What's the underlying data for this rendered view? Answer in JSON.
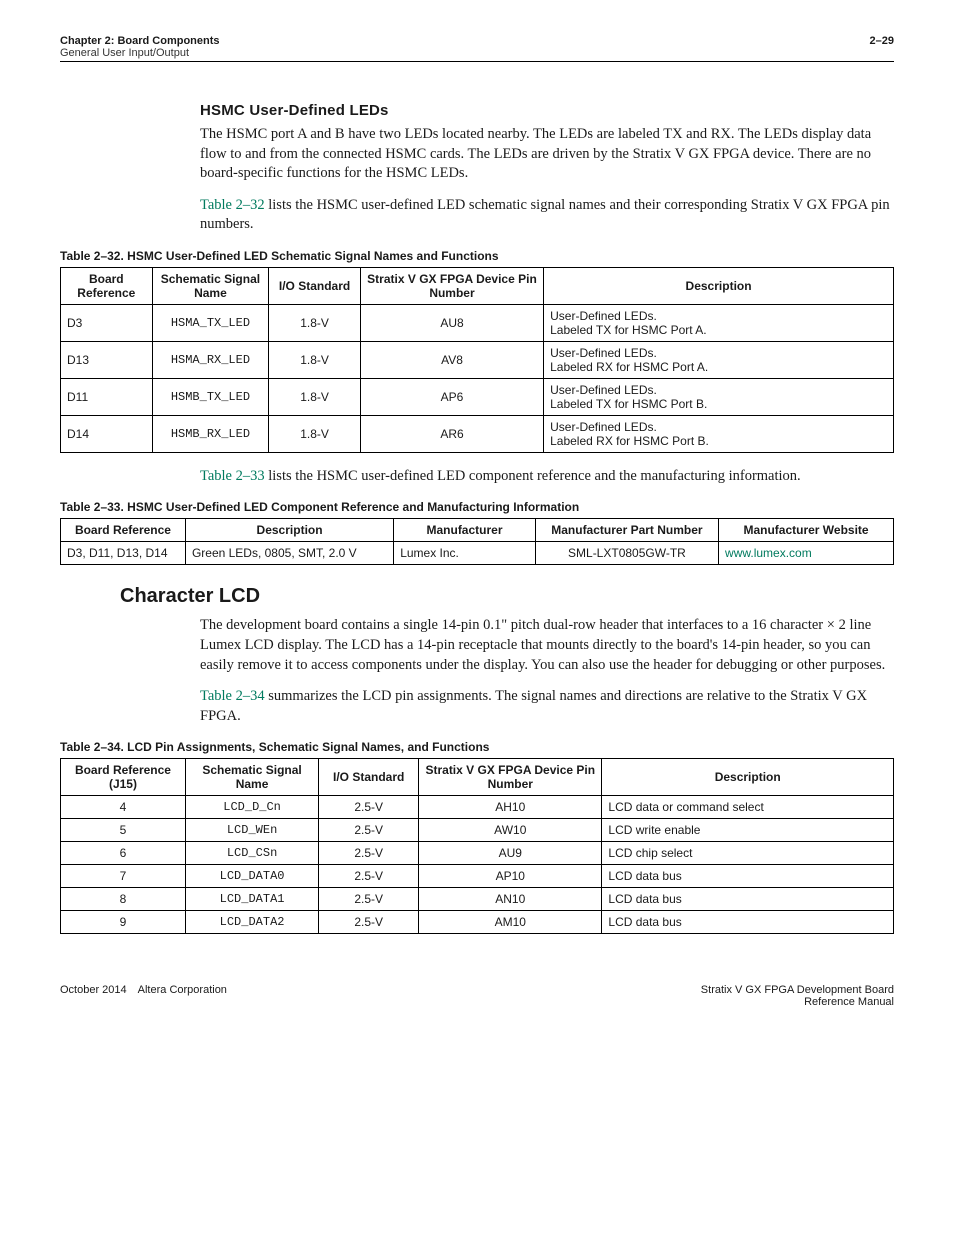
{
  "header": {
    "chapter": "Chapter 2: Board Components",
    "section": "General User Input/Output",
    "page": "2–29"
  },
  "s1": {
    "title": "HSMC User-Defined LEDs",
    "p1": "The HSMC port A and B have two LEDs located nearby. The LEDs are labeled TX and RX. The LEDs display data flow to and from the connected HSMC cards. The LEDs are driven by the Stratix V GX FPGA device. There are no board-specific functions for the HSMC LEDs.",
    "p2a": "Table 2–32",
    "p2b": " lists the HSMC user-defined LED schematic signal names and their corresponding Stratix V GX FPGA pin numbers."
  },
  "t32": {
    "caption": "Table 2–32. HSMC User-Defined LED Schematic Signal Names and Functions",
    "h": [
      "Board Reference",
      "Schematic Signal Name",
      "I/O Standard",
      "Stratix V GX FPGA Device Pin Number",
      "Description"
    ],
    "rows": [
      [
        "D3",
        "HSMA_TX_LED",
        "1.8-V",
        "AU8",
        "User-Defined LEDs.\nLabeled TX for HSMC Port A."
      ],
      [
        "D13",
        "HSMA_RX_LED",
        "1.8-V",
        "AV8",
        "User-Defined LEDs.\nLabeled RX for HSMC Port A."
      ],
      [
        "D11",
        "HSMB_TX_LED",
        "1.8-V",
        "AP6",
        "User-Defined LEDs.\nLabeled TX for HSMC Port B."
      ],
      [
        "D14",
        "HSMB_RX_LED",
        "1.8-V",
        "AR6",
        "User-Defined LEDs.\nLabeled RX for HSMC Port B."
      ]
    ]
  },
  "s2": {
    "p1a": "Table 2–33",
    "p1b": " lists the HSMC user-defined LED component reference and the manufacturing information."
  },
  "t33": {
    "caption": "Table 2–33. HSMC User-Defined LED Component Reference and Manufacturing Information",
    "h": [
      "Board Reference",
      "Description",
      "Manufacturer",
      "Manufacturer Part Number",
      "Manufacturer Website"
    ],
    "rows": [
      [
        "D3, D11, D13, D14",
        "Green LEDs, 0805, SMT, 2.0 V",
        "Lumex Inc.",
        "SML-LXT0805GW-TR",
        "www.lumex.com"
      ]
    ]
  },
  "s3": {
    "title": "Character LCD",
    "p1": "The development board contains a single 14-pin 0.1\" pitch dual-row header that interfaces to a 16 character × 2 line Lumex LCD display. The LCD has a 14-pin receptacle that mounts directly to the board's 14-pin header, so you can easily remove it to access components under the display. You can also use the header for debugging or other purposes.",
    "p2a": "Table 2–34",
    "p2b": " summarizes the LCD pin assignments. The signal names and directions are relative to the Stratix V GX FPGA."
  },
  "t34": {
    "caption": "Table 2–34. LCD Pin Assignments, Schematic Signal Names, and Functions",
    "h": [
      "Board Reference (J15)",
      "Schematic Signal Name",
      "I/O Standard",
      "Stratix V GX FPGA Device Pin Number",
      "Description"
    ],
    "rows": [
      [
        "4",
        "LCD_D_Cn",
        "2.5-V",
        "AH10",
        "LCD data or command select"
      ],
      [
        "5",
        "LCD_WEn",
        "2.5-V",
        "AW10",
        "LCD write enable"
      ],
      [
        "6",
        "LCD_CSn",
        "2.5-V",
        "AU9",
        "LCD chip select"
      ],
      [
        "7",
        "LCD_DATA0",
        "2.5-V",
        "AP10",
        "LCD data bus"
      ],
      [
        "8",
        "LCD_DATA1",
        "2.5-V",
        "AN10",
        "LCD data bus"
      ],
      [
        "9",
        "LCD_DATA2",
        "2.5-V",
        "AM10",
        "LCD data bus"
      ]
    ]
  },
  "footer": {
    "left": "October 2014 Altera Corporation",
    "right1": "Stratix V GX FPGA Development Board",
    "right2": "Reference Manual"
  }
}
